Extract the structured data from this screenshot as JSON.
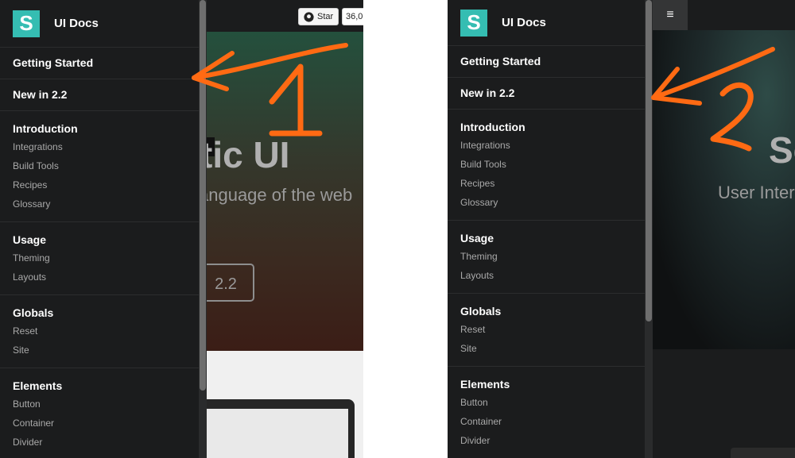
{
  "sidebar": {
    "brand": "UI Docs",
    "logo_letter": "S",
    "items": [
      "Getting Started",
      "New in 2.2"
    ],
    "sections": [
      {
        "title": "Introduction",
        "items": [
          "Integrations",
          "Build Tools",
          "Recipes",
          "Glossary"
        ]
      },
      {
        "title": "Usage",
        "items": [
          "Theming",
          "Layouts"
        ]
      },
      {
        "title": "Globals",
        "items": [
          "Reset",
          "Site"
        ]
      },
      {
        "title": "Elements",
        "items": [
          "Button",
          "Container",
          "Divider"
        ]
      }
    ]
  },
  "left_page": {
    "github_star": "Star",
    "github_count": "36,0",
    "hero_title": "tic UI",
    "hero_subtitle": "anguage of the web",
    "version_button": "2.2"
  },
  "right_page": {
    "hero_title": "Se",
    "hero_subtitle": "User Inter"
  },
  "annotations": {
    "left_number": "1",
    "right_number": "2",
    "color": "#ff6a13"
  },
  "colors": {
    "sidebar_bg": "#1b1c1d",
    "logo_teal": "#35bdb2"
  }
}
